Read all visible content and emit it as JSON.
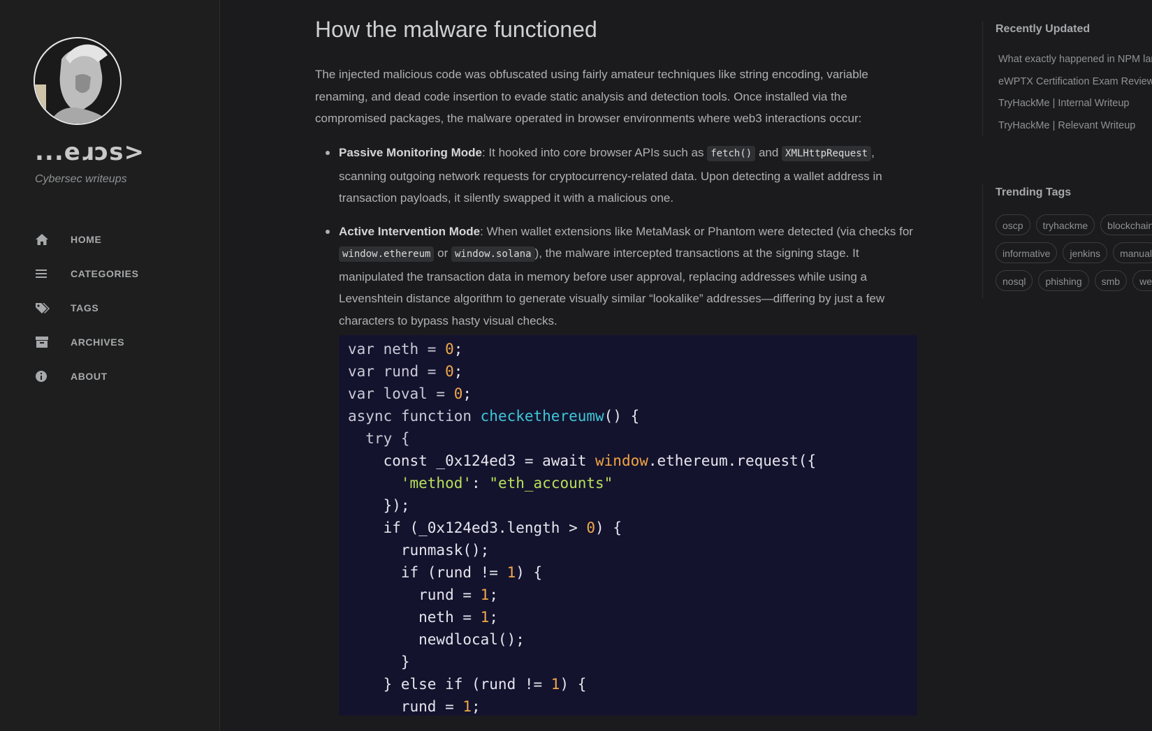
{
  "sidebar": {
    "logo_text": "...eɹɔs>",
    "subtitle": "Cybersec writeups",
    "nav": [
      {
        "label": "HOME",
        "icon": "home-icon"
      },
      {
        "label": "CATEGORIES",
        "icon": "list-icon"
      },
      {
        "label": "TAGS",
        "icon": "tags-icon"
      },
      {
        "label": "ARCHIVES",
        "icon": "archive-icon"
      },
      {
        "label": "ABOUT",
        "icon": "info-icon"
      }
    ]
  },
  "post": {
    "heading": "How the malware functioned",
    "intro": "The injected malicious code was obfuscated using fairly amateur techniques like string encoding, variable renaming, and dead code insertion to evade static analysis and detection tools. Once installed via the compromised packages, the malware operated in browser environments where web3 interactions occur:",
    "bullet1": {
      "title": "Passive Monitoring Mode",
      "text_a": ": It hooked into core browser APIs such as ",
      "code_a": "fetch()",
      "text_b": " and ",
      "code_b": "XMLHttpRequest",
      "text_c": ", scanning outgoing network requests for cryptocurrency-related data. Upon detecting a wallet address in transaction payloads, it silently swapped it with a malicious one."
    },
    "bullet2": {
      "title": "Active Intervention Mode",
      "text_a": ": When wallet extensions like MetaMask or Phantom were detected (via checks for ",
      "code_a": "window.ethereum",
      "text_b": " or ",
      "code_b": "window.solana",
      "text_c": "), the malware intercepted transactions at the signing stage. It manipulated the transaction data in memory before user approval, replacing addresses while using a Levenshtein distance algorithm to generate visually similar “lookalike” addresses—differing by just a few characters to bypass hasty visual checks."
    },
    "code": {
      "l1a": "var neth = ",
      "l1b": "0",
      "l1c": ";",
      "l2a": "var rund = ",
      "l2b": "0",
      "l2c": ";",
      "l3a": "var loval = ",
      "l3b": "0",
      "l3c": ";",
      "l4a": "async function ",
      "l4b": "checkethereumw",
      "l4c": "() {",
      "l5a": "  try {",
      "l6a": "    const _0x124ed3 = await ",
      "l6b": "window",
      "l6c": ".ethereum.request({",
      "l7a": "      ",
      "l7b": "'method'",
      "l7c": ": ",
      "l7d": "\"eth_accounts\"",
      "l8a": "    });",
      "l9a": "    if (_0x124ed3.length > ",
      "l9b": "0",
      "l9c": ") {",
      "l10a": "      runmask();",
      "l11a": "      if (rund != ",
      "l11b": "1",
      "l11c": ") {",
      "l12a": "        rund = ",
      "l12b": "1",
      "l12c": ";",
      "l13a": "        neth = ",
      "l13b": "1",
      "l13c": ";",
      "l14a": "        newdlocal();",
      "l15a": "      }",
      "l16a": "    } else if (rund != ",
      "l16b": "1",
      "l16c": ") {",
      "l17a": "      rund = ",
      "l17b": "1",
      "l17c": ";"
    }
  },
  "panel": {
    "recent_title": "Recently Updated",
    "recent": [
      "What exactly happened in NPM lar",
      "eWPTX Certification Exam Review",
      "TryHackMe | Internal Writeup",
      "TryHackMe | Relevant Writeup"
    ],
    "trending_title": "Trending Tags",
    "tags_row1": [
      "oscp",
      "tryhackme",
      "blockchain"
    ],
    "tags_row2": [
      "informative",
      "jenkins",
      "manual"
    ],
    "tags_row3": [
      "nosql",
      "phishing",
      "smb",
      "web"
    ]
  }
}
